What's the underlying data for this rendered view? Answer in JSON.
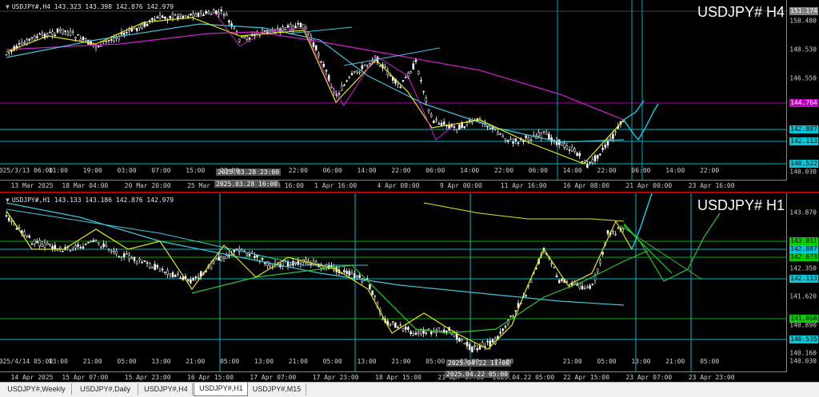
{
  "top_chart": {
    "info": "USDJPY#,H4  143.323 143.398 142.876 142.979",
    "watermark": "USDJPY# H4",
    "price_ticks": [
      "150.480",
      "148.530",
      "146.550",
      "140.030"
    ],
    "price_labels": [
      {
        "text": "151.174",
        "bg": "#808080",
        "fg": "#ffffff"
      },
      {
        "text": "144.764",
        "bg": "#c000c0",
        "fg": "#ffffff"
      },
      {
        "text": "142.887",
        "bg": "#00c8d8",
        "fg": "#000000"
      },
      {
        "text": "142.113",
        "bg": "#00c8d8",
        "fg": "#000000"
      },
      {
        "text": "140.522",
        "bg": "#00c8d8",
        "fg": "#000000"
      }
    ],
    "price_ticks_low": [
      "140.030"
    ],
    "time_labels": [
      "13 Mar 2025",
      "18 Mar 04:00",
      "20 Mar 20:00",
      "25 Mar 08:00",
      "2025.03.28 16:00",
      "1 Apr 16:00",
      "4 Apr 08:00",
      "9 Apr 00:00",
      "11 Apr 16:00",
      "16 Apr 08:00",
      "21 Apr 00:00",
      "23 Apr 16:00"
    ],
    "inner_time_labels": [
      "2025/3/13 06:00",
      "11:00",
      "19:00",
      "03:00",
      "07:00",
      "15:00",
      "23:00",
      "2025.03.28 23:00",
      "22:00",
      "06:00",
      "14:00",
      "22:00",
      "06:00",
      "14:00",
      "22:00",
      "06:00",
      "14:00",
      "22:00",
      "06:00",
      "14:00",
      "22:00"
    ],
    "highlight_top": "2025.03.28 23:00",
    "highlight_bottom": "2025.03.28 16:00"
  },
  "bottom_chart": {
    "info": "USDJPY#,H1  143.133 143.186 142.876 142.979",
    "watermark": "USDJPY# H1",
    "price_ticks": [
      "143.870",
      "142.350",
      "141.620",
      "140.890",
      "140.160",
      "140.030"
    ],
    "price_labels": [
      {
        "text": "143.011",
        "bg": "#00d000",
        "fg": "#000000"
      },
      {
        "text": "142.887",
        "bg": "#00c8d8",
        "fg": "#000000"
      },
      {
        "text": "142.673",
        "bg": "#00d000",
        "fg": "#000000"
      },
      {
        "text": "142.113",
        "bg": "#00c8d8",
        "fg": "#000000"
      },
      {
        "text": "141.068",
        "bg": "#00d000",
        "fg": "#000000"
      },
      {
        "text": "140.535",
        "bg": "#00c8d8",
        "fg": "#000000"
      }
    ],
    "time_labels": [
      "14 Apr 2025",
      "15 Apr 07:00",
      "15 Apr 23:00",
      "16 Apr 15:00",
      "17 Apr 07:00",
      "17 Apr 23:00",
      "18 Apr 15:00",
      "21 Apr 07:00",
      "2025.04.22 05:00",
      "22 Apr 15:00",
      "23 Apr 07:00",
      "23 Apr 23:00"
    ],
    "inner_time_labels": [
      "2025/4/14 05:00",
      "13:00",
      "21:00",
      "05:00",
      "13:00",
      "21:00",
      "05:00",
      "13:00",
      "21:00",
      "05:00",
      "13:00",
      "21:00",
      "05:00",
      "13:00",
      "21:00",
      "2025.04.22 11:00",
      "21:00",
      "05:00",
      "13:00",
      "21:00",
      "05:00"
    ],
    "highlight_top": "2025.04.22 11:00",
    "highlight_bottom": "2025.04.22 05:00"
  },
  "tabs": [
    "USDJPY#,Weekly",
    "USDJPY#,Daily",
    "USDJPY#,H4",
    "USDJPY#,H1",
    "USDJPY#,M15"
  ],
  "active_tab": "USDJPY#,H1",
  "colors": {
    "background": "#000000",
    "candle": "#ffffff",
    "ma_yellow": "#e8e800",
    "ma_cyan": "#3cc8e0",
    "ma_magenta": "#d020d0",
    "ma_green": "#2ec82e",
    "projection": "#00e0ff"
  }
}
